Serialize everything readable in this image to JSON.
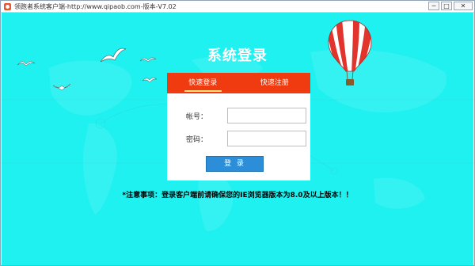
{
  "window": {
    "title": "领跑者系统客户端-http://www.qipaob.com-版本-V7.02",
    "controls": {
      "minimize": "─",
      "maximize": "□",
      "close": "✕"
    }
  },
  "login": {
    "title": "系统登录",
    "tabs": [
      {
        "label": "快速登录",
        "active": true
      },
      {
        "label": "快速注册",
        "active": false
      }
    ],
    "account_label": "帐号：",
    "account_value": "",
    "password_label": "密码：",
    "password_value": "",
    "submit_label": "登 录"
  },
  "notice": "*注意事项：登录客户端前请确保您的IE浏览器版本为8.0及以上版本！！",
  "colors": {
    "background": "#1ff0f0",
    "tab_bar": "#f03a10",
    "button": "#2c8ed8",
    "tab_underline": "#ffe37a"
  },
  "icons": [
    "app-logo-icon",
    "hot-air-balloon-icon",
    "seagull-icon",
    "world-map-background"
  ]
}
